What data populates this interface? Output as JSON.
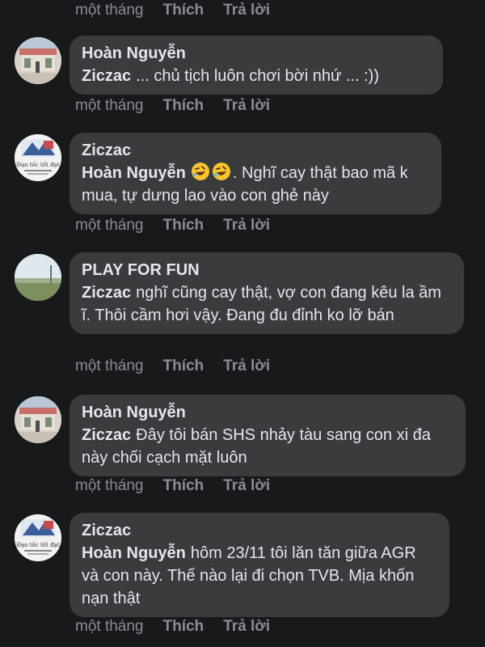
{
  "labels": {
    "time": "một tháng",
    "like": "Thích",
    "reply": "Trả lời"
  },
  "comments": [
    {
      "author": "Hoàn Nguyễn",
      "mention": "Ziczac",
      "text": "... chủ tịch luôn chơi bời nhứ ... :))"
    },
    {
      "author": "Ziczac",
      "mention": "Hoàn Nguyễn",
      "text": ". Nghĩ cay thật bao mã k mua, tự dưng lao vào con ghẻ này",
      "emojis": [
        "rolling-on-floor-laughing-emoji",
        "rolling-on-floor-laughing-emoji"
      ]
    },
    {
      "author": "PLAY FOR FUN",
      "mention": "Ziczac",
      "text": "nghĩ cũng cay thật, vợ con đang kêu la ầm ĩ. Thôi cầm hơi vậy. Đang đu đỉnh ko lỡ bán"
    },
    {
      "author": "Hoàn Nguyễn",
      "mention": "Ziczac",
      "text": "Đây tôi bán SHS nhảy tàu sang con xi đa này chối cạch mặt luôn"
    },
    {
      "author": "Ziczac",
      "mention": "Hoàn Nguyễn",
      "text": "hôm 23/11 tôi lăn tăn giữa AGR và con này. Thế nào lại đi chọn TVB. Mịa khốn nạn thật"
    }
  ],
  "colors": {
    "background": "#18191a",
    "bubble": "#3a3b3c",
    "text": "#e4e6eb",
    "meta": "#8a8d91"
  }
}
